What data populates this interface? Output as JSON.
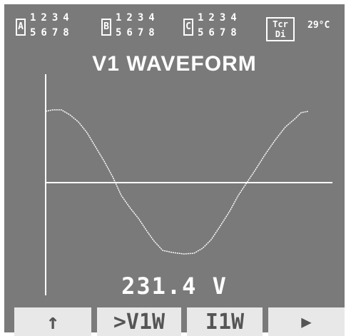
{
  "status": {
    "groups": [
      {
        "letter": "A",
        "row1": "1234",
        "row2": "5678"
      },
      {
        "letter": "B",
        "row1": "1234",
        "row2": "5678"
      },
      {
        "letter": "C",
        "row1": "1234",
        "row2": "5678"
      }
    ],
    "tcr": {
      "line1": "Tcr",
      "line2": "Di"
    },
    "temperature": "29°C"
  },
  "title": "V1  WAVEFORM",
  "reading": "231.4 V",
  "softkeys": [
    {
      "label": "↑",
      "icon": "up-arrow-icon"
    },
    {
      "label": ">V1W"
    },
    {
      "label": "I1W"
    },
    {
      "label": "▶",
      "icon": "next-arrow-icon"
    }
  ],
  "colors": {
    "background": "#7a7a7a",
    "foreground": "#ffffff",
    "softkey_bg": "#e8e8e8",
    "softkey_fg": "#555555"
  }
}
